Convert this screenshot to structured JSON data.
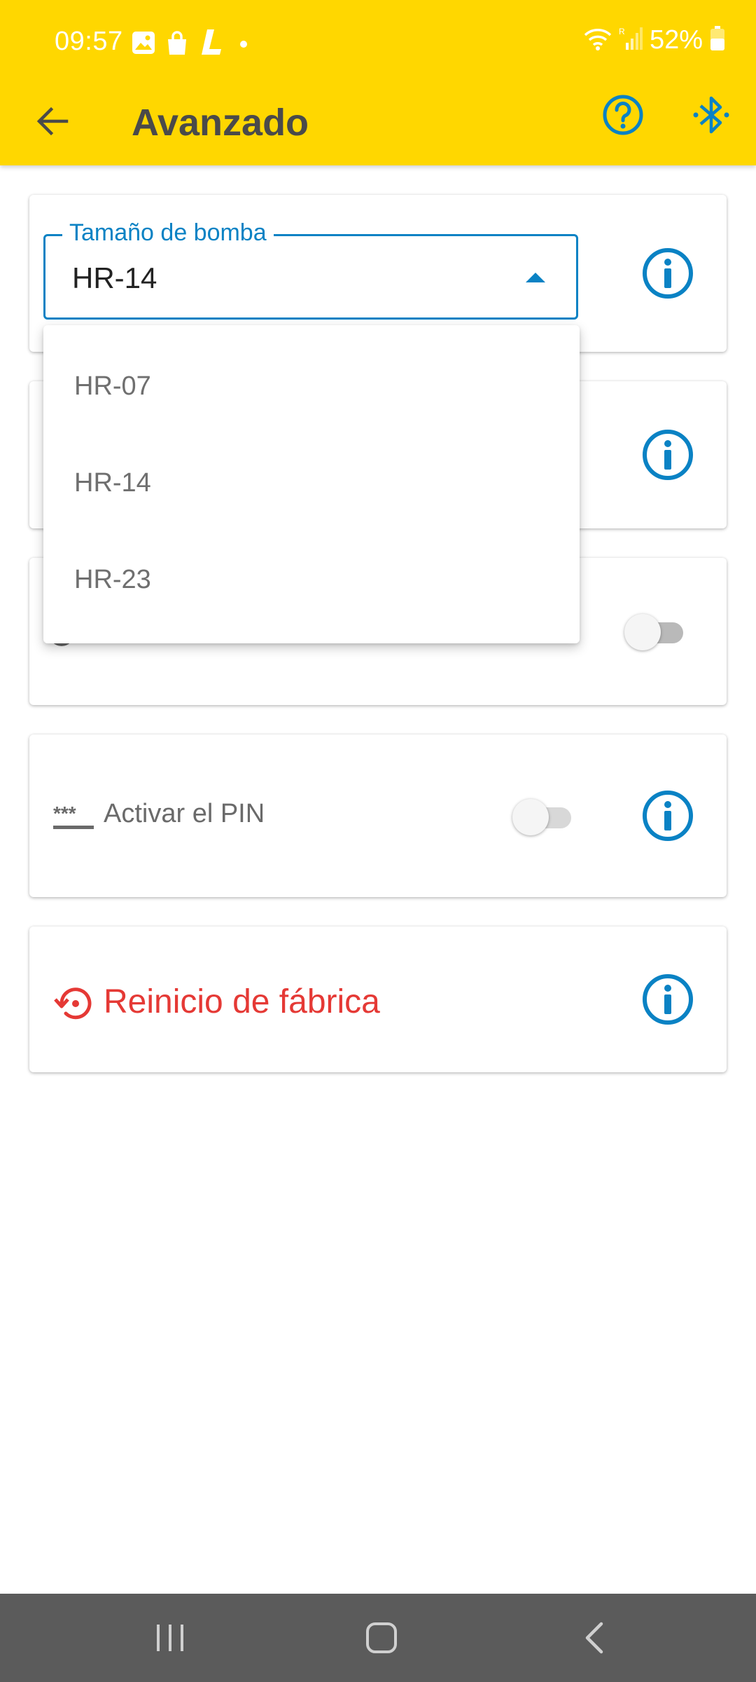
{
  "status_bar": {
    "time": "09:57",
    "battery": "52%",
    "icons": [
      "gallery-icon",
      "shopping-bag-icon",
      "l-app-icon",
      "dot-icon",
      "wifi-icon",
      "signal-icon",
      "battery-icon"
    ]
  },
  "app_bar": {
    "title": "Avanzado",
    "back_icon": "arrow-left-icon",
    "help_icon": "help-circle-icon",
    "bluetooth_icon": "bluetooth-icon"
  },
  "pump_size": {
    "label": "Tamaño de bomba",
    "value": "HR-14",
    "options": [
      "HR-07",
      "HR-14",
      "HR-23"
    ]
  },
  "pin": {
    "label": "Activar el PIN",
    "enabled": false
  },
  "third_card": {
    "enabled": false
  },
  "factory_reset": {
    "label": "Reinicio de fábrica"
  },
  "colors": {
    "accent_yellow": "#FFD700",
    "primary_blue": "#0A82C4",
    "danger_red": "#E53935"
  }
}
